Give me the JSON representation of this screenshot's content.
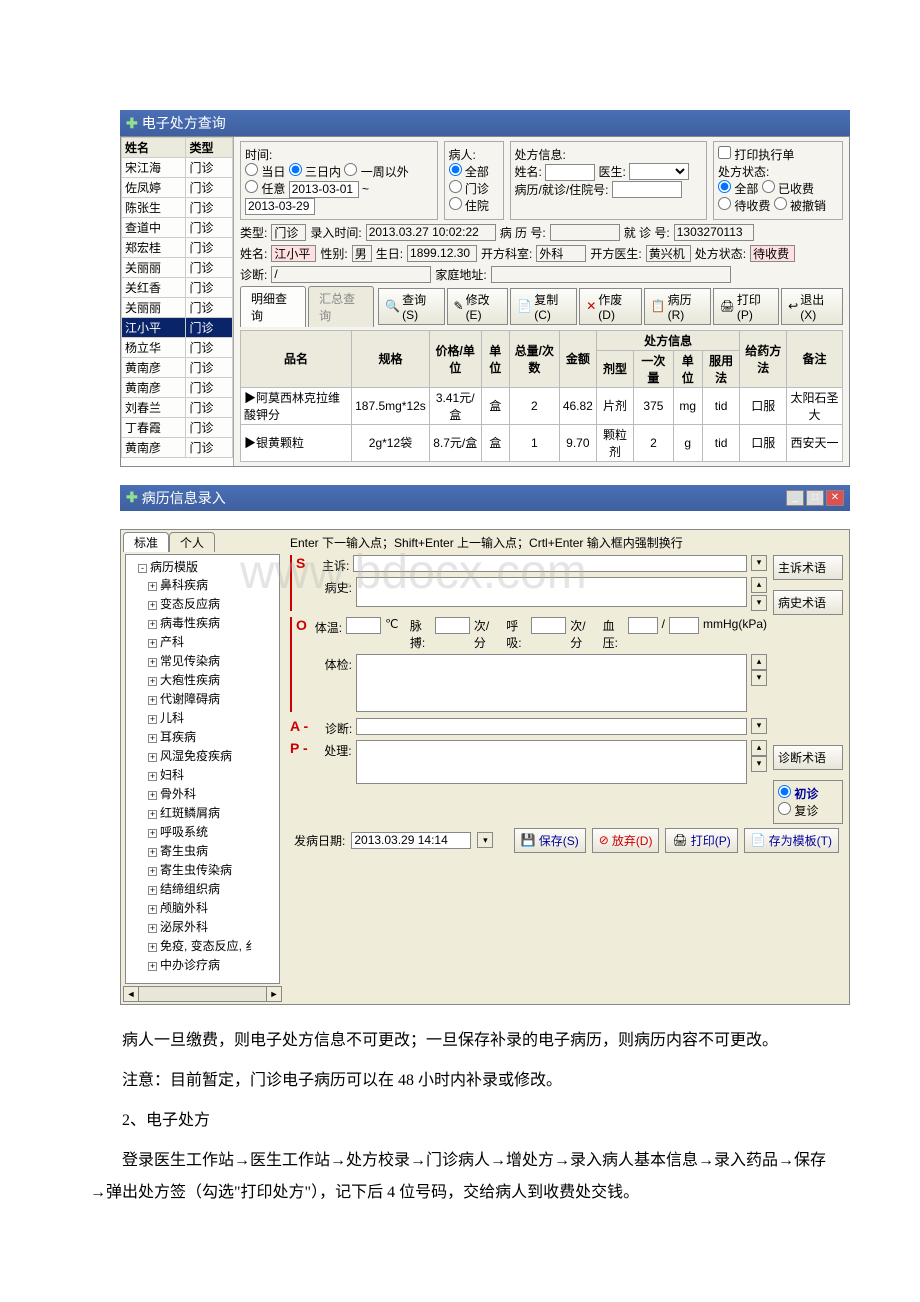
{
  "window1": {
    "title": "电子处方查询",
    "list_headers": [
      "姓名",
      "类型"
    ],
    "list_rows": [
      [
        "宋江海",
        "门诊"
      ],
      [
        "佐凤婷",
        "门诊"
      ],
      [
        "陈张生",
        "门诊"
      ],
      [
        "查道中",
        "门诊"
      ],
      [
        "郑宏桂",
        "门诊"
      ],
      [
        "关丽丽",
        "门诊"
      ],
      [
        "关红香",
        "门诊"
      ],
      [
        "关丽丽",
        "门诊"
      ],
      [
        "江小平",
        "门诊"
      ],
      [
        "杨立华",
        "门诊"
      ],
      [
        "黄南彦",
        "门诊"
      ],
      [
        "黄南彦",
        "门诊"
      ],
      [
        "刘春兰",
        "门诊"
      ],
      [
        "丁春霞",
        "门诊"
      ],
      [
        "黄南彦",
        "门诊"
      ]
    ],
    "selected_index": 8,
    "filters": {
      "time_label": "时间:",
      "today": "当日",
      "three_days": "三日内",
      "one_week": "一周以外",
      "any": "任意",
      "date_from": "2013-03-01",
      "date_to": "2013-03-29",
      "patient_label": "病人:",
      "all": "全部",
      "outpatient": "门诊",
      "inpatient": "住院",
      "rx_info_label": "处方信息:",
      "name": "姓名:",
      "doctor": "医生:",
      "record_label": "病历/就诊/住院号:",
      "print_exec": "打印执行单",
      "rx_status_label": "处方状态:",
      "status_all": "全部",
      "status_paid": "已收费",
      "status_unpaid": "待收费",
      "status_void": "被撤销"
    },
    "info": {
      "type_label": "类型:",
      "type_val": "门诊",
      "entry_time_label": "录入时间:",
      "entry_time_val": "2013.03.27 10:02:22",
      "record_no_label": "病 历 号:",
      "visit_no_label": "就 诊 号:",
      "visit_no_val": "1303270113",
      "name_label": "姓名:",
      "name_val": "江小平",
      "sex_label": "性别:",
      "sex_val": "男",
      "birth_label": "生日:",
      "birth_val": "1899.12.30",
      "dept_label": "开方科室:",
      "dept_val": "外科",
      "doctor_label": "开方医生:",
      "doctor_val": "黄兴机",
      "status_label": "处方状态:",
      "status_val": "待收费",
      "dx_label": "诊断:",
      "dx_val": "/",
      "addr_label": "家庭地址:"
    },
    "tabs": {
      "detail": "明细查询",
      "summary": "汇总查询"
    },
    "buttons": {
      "query": "查询(S)",
      "modify": "修改(E)",
      "copy": "复制(C)",
      "void": "作废(D)",
      "record": "病历(R)",
      "print": "打印(P)",
      "exit": "退出(X)"
    },
    "drug_headers": {
      "name": "品名",
      "spec": "规格",
      "price": "价格/单位",
      "unit": "单位",
      "qty": "总量/次数",
      "amount": "金额",
      "rxinfo": "处方信息",
      "dosage_form": "剂型",
      "dose": "一次量",
      "dose_unit": "单位",
      "freq": "服用法",
      "method": "给药方法",
      "remark": "备注"
    },
    "drugs": [
      {
        "name": "阿莫西林克拉维酸钾分",
        "spec": "187.5mg*12s",
        "price": "3.41元/盒",
        "unit": "盒",
        "qty": "2",
        "amount": "46.82",
        "form": "片剂",
        "dose": "375",
        "dose_unit": "mg",
        "freq": "tid",
        "method": "口服",
        "remark": "太阳石圣大"
      },
      {
        "name": "银黄颗粒",
        "spec": "2g*12袋",
        "price": "8.7元/盒",
        "unit": "盒",
        "qty": "1",
        "amount": "9.70",
        "form": "颗粒剂",
        "dose": "2",
        "dose_unit": "g",
        "freq": "tid",
        "method": "口服",
        "remark": "西安天一"
      }
    ]
  },
  "window2": {
    "title": "病历信息录入",
    "treetabs": {
      "std": "标准",
      "personal": "个人"
    },
    "tree_root": "病历模版",
    "tree_items": [
      "鼻科疾病",
      "变态反应病",
      "病毒性疾病",
      "产科",
      "常见传染病",
      "大疱性疾病",
      "代谢障碍病",
      "儿科",
      "耳疾病",
      "风湿免疫疾病",
      "妇科",
      "骨外科",
      "红斑鳞屑病",
      "呼吸系统",
      "寄生虫病",
      "寄生虫传染病",
      "结缔组织病",
      "颅脑外科",
      "泌尿外科",
      "免疫, 变态反应, 纟",
      "中办诊疗病"
    ],
    "hint": "Enter 下一输入点；Shift+Enter 上一输入点；Crtl+Enter 输入框内强制换行",
    "fields": {
      "s_marker": "S",
      "chief": "主诉:",
      "history": "病史:",
      "o_marker": "O",
      "temp": "体温:",
      "temp_unit": "℃",
      "pulse": "脉搏:",
      "per_min": "次/分",
      "resp": "呼吸:",
      "bp": "血压:",
      "slash": "/",
      "bp_unit": "mmHg(kPa)",
      "exam": "体检:",
      "a_marker": "A -",
      "dx": "诊断:",
      "p_marker": "P -",
      "tx": "处理:"
    },
    "sidebtns": {
      "chief_term": "主诉术语",
      "hist_term": "病史术语",
      "dx_term": "诊断术语"
    },
    "visit_type": {
      "first": "初诊",
      "return": "复诊"
    },
    "onset_label": "发病日期:",
    "onset_val": "2013.03.29 14:14",
    "btns": {
      "save": "保存(S)",
      "discard": "放弃(D)",
      "print": "打印(P)",
      "save_tpl": "存为模板(T)"
    }
  },
  "article": {
    "p1": "病人一旦缴费，则电子处方信息不可更改；一旦保存补录的电子病历，则病历内容不可更改。",
    "p2": "注意：目前暂定，门诊电子病历可以在 48 小时内补录或修改。",
    "p3": "2、电子处方",
    "p4": "登录医生工作站→医生工作站→处方校录→门诊病人→增处方→录入病人基本信息→录入药品→保存→弹出处方签（勾选\"打印处方\"），记下后 4 位号码，交给病人到收费处交钱。"
  },
  "watermark": "www.bdocx.com"
}
